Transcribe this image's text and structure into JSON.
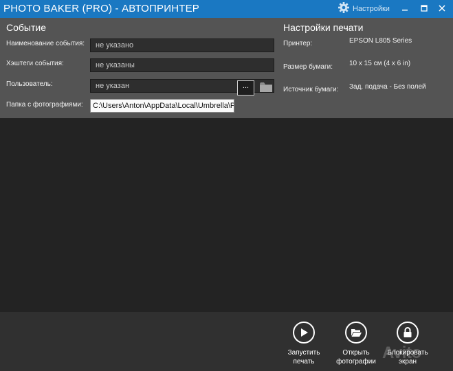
{
  "titlebar": {
    "title": "PHOTO BAKER (PRO) - АВТОПРИНТЕР",
    "settings_label": "Настройки",
    "accent_color": "#1a78c2"
  },
  "event": {
    "section_title": "Событие",
    "name_label": "Наименование события:",
    "name_value": "не указано",
    "hashtags_label": "Хэштеги события:",
    "hashtags_value": "не указаны",
    "user_label": "Пользователь:",
    "user_value": "не указан",
    "folder_label": "Папка с фотографиями:",
    "folder_value": "C:\\Users\\Anton\\AppData\\Local\\Umbrella\\Pho",
    "browse_label": "..."
  },
  "print": {
    "section_title": "Настройки печати",
    "printer_label": "Принтер:",
    "printer_value": "EPSON L805 Series",
    "paper_label": "Размер бумаги:",
    "paper_value": "10 x 15 см (4 x 6 in)",
    "source_label": "Источник бумаги:",
    "source_value": "Зад. подача - Без полей"
  },
  "actions": {
    "start_label": "Запустить\nпечать",
    "open_label": "Открыть\nфотографии",
    "lock_label": "Блокировать\nэкран"
  },
  "watermark": "Avito",
  "icons": [
    "gear-icon",
    "minimize-icon",
    "maximize-icon",
    "close-icon",
    "folder-icon",
    "play-icon",
    "folder-open-icon",
    "lock-icon"
  ]
}
